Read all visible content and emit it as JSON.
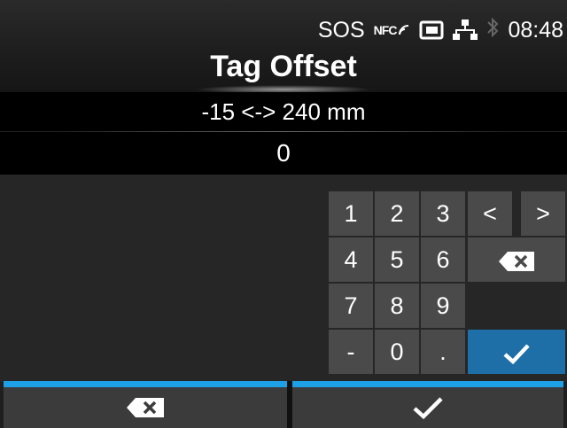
{
  "status_bar": {
    "sos": "SOS",
    "nfc": "NFC",
    "time": "08:48",
    "icons": [
      "nfc-icon",
      "sd-card-icon",
      "network-icon",
      "bluetooth-icon"
    ]
  },
  "header": {
    "title": "Tag Offset"
  },
  "range": {
    "text": "-15 <-> 240 mm"
  },
  "value": {
    "current": "0"
  },
  "keypad": {
    "digits": [
      "1",
      "2",
      "3",
      "4",
      "5",
      "6",
      "7",
      "8",
      "9",
      "-",
      "0",
      "."
    ],
    "left": "<",
    "right": ">",
    "icons": [
      "backspace-icon",
      "enter-check-icon"
    ]
  },
  "bottom_bar": {
    "icons": [
      "back-delete-icon",
      "confirm-check-icon"
    ],
    "accent_color": "#1ea0e6"
  },
  "colors": {
    "key": "#4a4a4a",
    "enter_key": "#1e6fa8",
    "background": "#1f1f1f"
  }
}
